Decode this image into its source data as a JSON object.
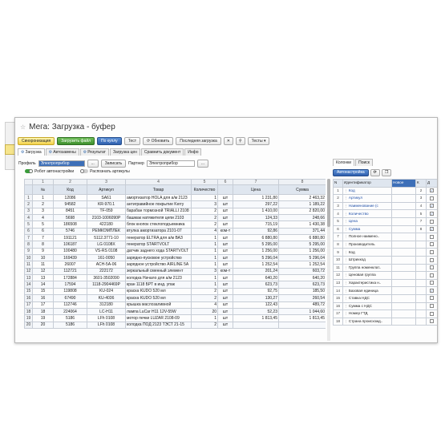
{
  "window": {
    "title": "Мега: Загрузка - буфер"
  },
  "toolbar": {
    "buttons": [
      "Синхронизация",
      "Загрузить файл",
      "По куплу",
      "Тест",
      "Обновить",
      "Последняя загрузка",
      "Тесты"
    ]
  },
  "tabs": [
    "Загрузка",
    "Автозамены",
    "Результат",
    "Загрузка цен",
    "Сравнить документ",
    "Инфо"
  ],
  "profile": {
    "label": "Профиль",
    "value": "Электроприбор",
    "save": "Записать",
    "partner_label": "Партнер",
    "partner_value": "Электроприбор"
  },
  "checks": [
    {
      "label": "Робот автонастройки",
      "on": true
    },
    {
      "label": "Распознать артикулы",
      "on": false
    }
  ],
  "grid": {
    "col_numbers": [
      "",
      "1",
      "2",
      "3",
      "4",
      "5",
      "6",
      "7",
      "8"
    ],
    "headers": [
      "",
      "№",
      "Код",
      "Артикул",
      "Товар",
      "Количество",
      "",
      "Цена",
      "Сумма"
    ],
    "rows": [
      [
        "1",
        "1",
        "12086",
        "SA61",
        "амортизатор HOLA для а/м 2123",
        "1",
        "шт",
        "1 231,80",
        "2 463,32"
      ],
      [
        "2",
        "2",
        "94582",
        "KR-970.1",
        "антигравийное покрытие Kerry",
        "3",
        "шт",
        "297,22",
        "1 189,22"
      ],
      [
        "3",
        "3",
        "8451",
        "TF-059",
        "барабан тормозной TRIALLI 2108",
        "2",
        "шт",
        "1 410,00",
        "2 820,00"
      ],
      [
        "4",
        "4",
        "5698",
        "2103-1006090P",
        "башмак натяжителя цепи 2103",
        "2",
        "шт",
        "124,33",
        "248,66"
      ],
      [
        "5",
        "5",
        "186508",
        "422180",
        "блок кнопок стеклоподъемника",
        "2",
        "шт",
        "715,19",
        "1 430,38"
      ],
      [
        "6",
        "6",
        "5746",
        "РЕМКОМПЛЕК",
        "втулка амортизатора 2101-07",
        "4",
        "ком-т",
        "92,86",
        "371,44"
      ],
      [
        "7",
        "7",
        "191121",
        "5112.3771-10",
        "генератор ELTRA для а/м ВАЗ",
        "1",
        "шт",
        "6 880,80",
        "6 880,80"
      ],
      [
        "8",
        "8",
        "106187",
        "LG 0108X",
        "генератор STARTVOLT",
        "1",
        "шт",
        "5 295,00",
        "5 295,00"
      ],
      [
        "9",
        "9",
        "100480",
        "VS-RS 0108",
        "датчик заднего хода STARTVOLT",
        "1",
        "шт",
        "1 256,00",
        "1 256,00"
      ],
      [
        "10",
        "10",
        "169439",
        "161-0050",
        "зарядно-пусковое устройство",
        "1",
        "шт",
        "5 296,04",
        "5 296,04"
      ],
      [
        "11",
        "11",
        "26007",
        "ACH-5A-06",
        "зарядное устройство AIRLINE 5A",
        "1",
        "шт",
        "1 252,54",
        "1 252,54"
      ],
      [
        "12",
        "12",
        "112721",
        "222172",
        "зеркальный сменный элемент",
        "3",
        "ком-т",
        "201,24",
        "603,72"
      ],
      [
        "13",
        "13",
        "172884",
        "3601-3502090",
        "колодка Начало для а/м 2123",
        "1",
        "шт",
        "640,20",
        "640,20"
      ],
      [
        "14",
        "14",
        "17594",
        "1118-2904469P",
        "кран 1118 БРТ в инд. упак",
        "1",
        "шт",
        "623,73",
        "623,73"
      ],
      [
        "15",
        "15",
        "119808",
        "KU-024",
        "краска KUDO 520 мл",
        "2",
        "шт",
        "92,75",
        "185,50"
      ],
      [
        "16",
        "16",
        "67490",
        "KU-4036",
        "краска KUDO 520 мл",
        "2",
        "шт",
        "130,27",
        "260,54"
      ],
      [
        "17",
        "17",
        "112746",
        "312180",
        "крышка маслозаливной",
        "4",
        "шт",
        "122,43",
        "489,72"
      ],
      [
        "18",
        "18",
        "224064",
        "LC-H11",
        "лампа LuCar H11 12V-55W",
        "20",
        "шт",
        "52,23",
        "1 044,60"
      ],
      [
        "19",
        "19",
        "5186",
        "LFh 0108",
        "мотор печки LUZAR 2108-09",
        "1",
        "шт",
        "1 813,45",
        "1 813,45"
      ],
      [
        "20",
        "20",
        "5186",
        "LFh 0108",
        "колодка ПОД 2123 ТЭСТ 21-15",
        "2",
        "шт",
        "",
        ""
      ]
    ]
  },
  "right_panel": {
    "tabs": [
      "Колонки",
      "Поиск"
    ],
    "autosetup": "Автонастройка",
    "headers": [
      "N",
      "Идентификатор",
      "Новое",
      "К",
      "Д"
    ],
    "rows": [
      {
        "n": "1",
        "name": "Код",
        "new": "",
        "k": "2",
        "checked": true,
        "blue": true
      },
      {
        "n": "2",
        "name": "Артикул",
        "new": "",
        "k": "3",
        "checked": false,
        "blue": true
      },
      {
        "n": "3",
        "name": "Наименование (с",
        "new": "",
        "k": "4",
        "checked": true,
        "blue": true
      },
      {
        "n": "4",
        "name": "Количество",
        "new": "",
        "k": "5",
        "checked": true,
        "blue": true
      },
      {
        "n": "5",
        "name": "Цена",
        "new": "",
        "k": "7",
        "checked": false,
        "blue": true
      },
      {
        "n": "6",
        "name": "Сумма",
        "new": "",
        "k": "8",
        "checked": true,
        "blue": true
      },
      {
        "n": "7",
        "name": "Полное наимено..",
        "new": "",
        "k": "",
        "checked": false,
        "blue": false
      },
      {
        "n": "8",
        "name": "Производитель",
        "new": "",
        "k": "",
        "checked": false,
        "blue": false
      },
      {
        "n": "9",
        "name": "Код",
        "new": "",
        "k": "",
        "checked": false,
        "blue": false
      },
      {
        "n": "10",
        "name": "Штрихкод",
        "new": "",
        "k": "",
        "checked": false,
        "blue": false
      },
      {
        "n": "11",
        "name": "Группа номенклат..",
        "new": "",
        "k": "",
        "checked": false,
        "blue": false
      },
      {
        "n": "12",
        "name": "Ценовая группа",
        "new": "",
        "k": "",
        "checked": false,
        "blue": false
      },
      {
        "n": "13",
        "name": "Характеристика н..",
        "new": "",
        "k": "",
        "checked": false,
        "blue": false
      },
      {
        "n": "14",
        "name": "Базовая единица",
        "new": "",
        "k": "",
        "checked": true,
        "blue": false
      },
      {
        "n": "15",
        "name": "Ставка НДС",
        "new": "",
        "k": "",
        "checked": false,
        "blue": false
      },
      {
        "n": "16",
        "name": "Сумма с НДС",
        "new": "",
        "k": "",
        "checked": false,
        "blue": false
      },
      {
        "n": "17",
        "name": "Номер ГТД",
        "new": "",
        "k": "",
        "checked": false,
        "blue": false
      },
      {
        "n": "18",
        "name": "Страна происхожд..",
        "new": "",
        "k": "",
        "checked": false,
        "blue": false
      }
    ]
  }
}
